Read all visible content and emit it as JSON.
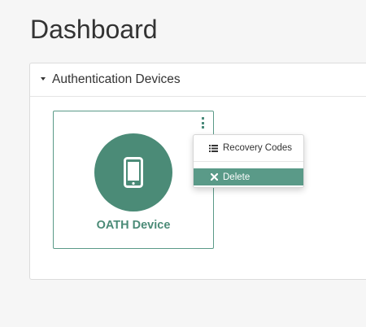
{
  "page": {
    "title": "Dashboard"
  },
  "panel": {
    "title": "Authentication Devices",
    "expanded": true,
    "icon": "caret-down-icon"
  },
  "device": {
    "name": "OATH Device",
    "icon": "mobile-phone-icon",
    "accent_color": "#4b8b77",
    "menu_icon": "kebab-menu-icon"
  },
  "menu": {
    "items": [
      {
        "label": "Recovery Codes",
        "icon": "list-icon",
        "highlighted": false
      },
      {
        "label": "Delete",
        "icon": "close-icon",
        "highlighted": true
      }
    ],
    "highlight_color": "#5a9a88"
  }
}
